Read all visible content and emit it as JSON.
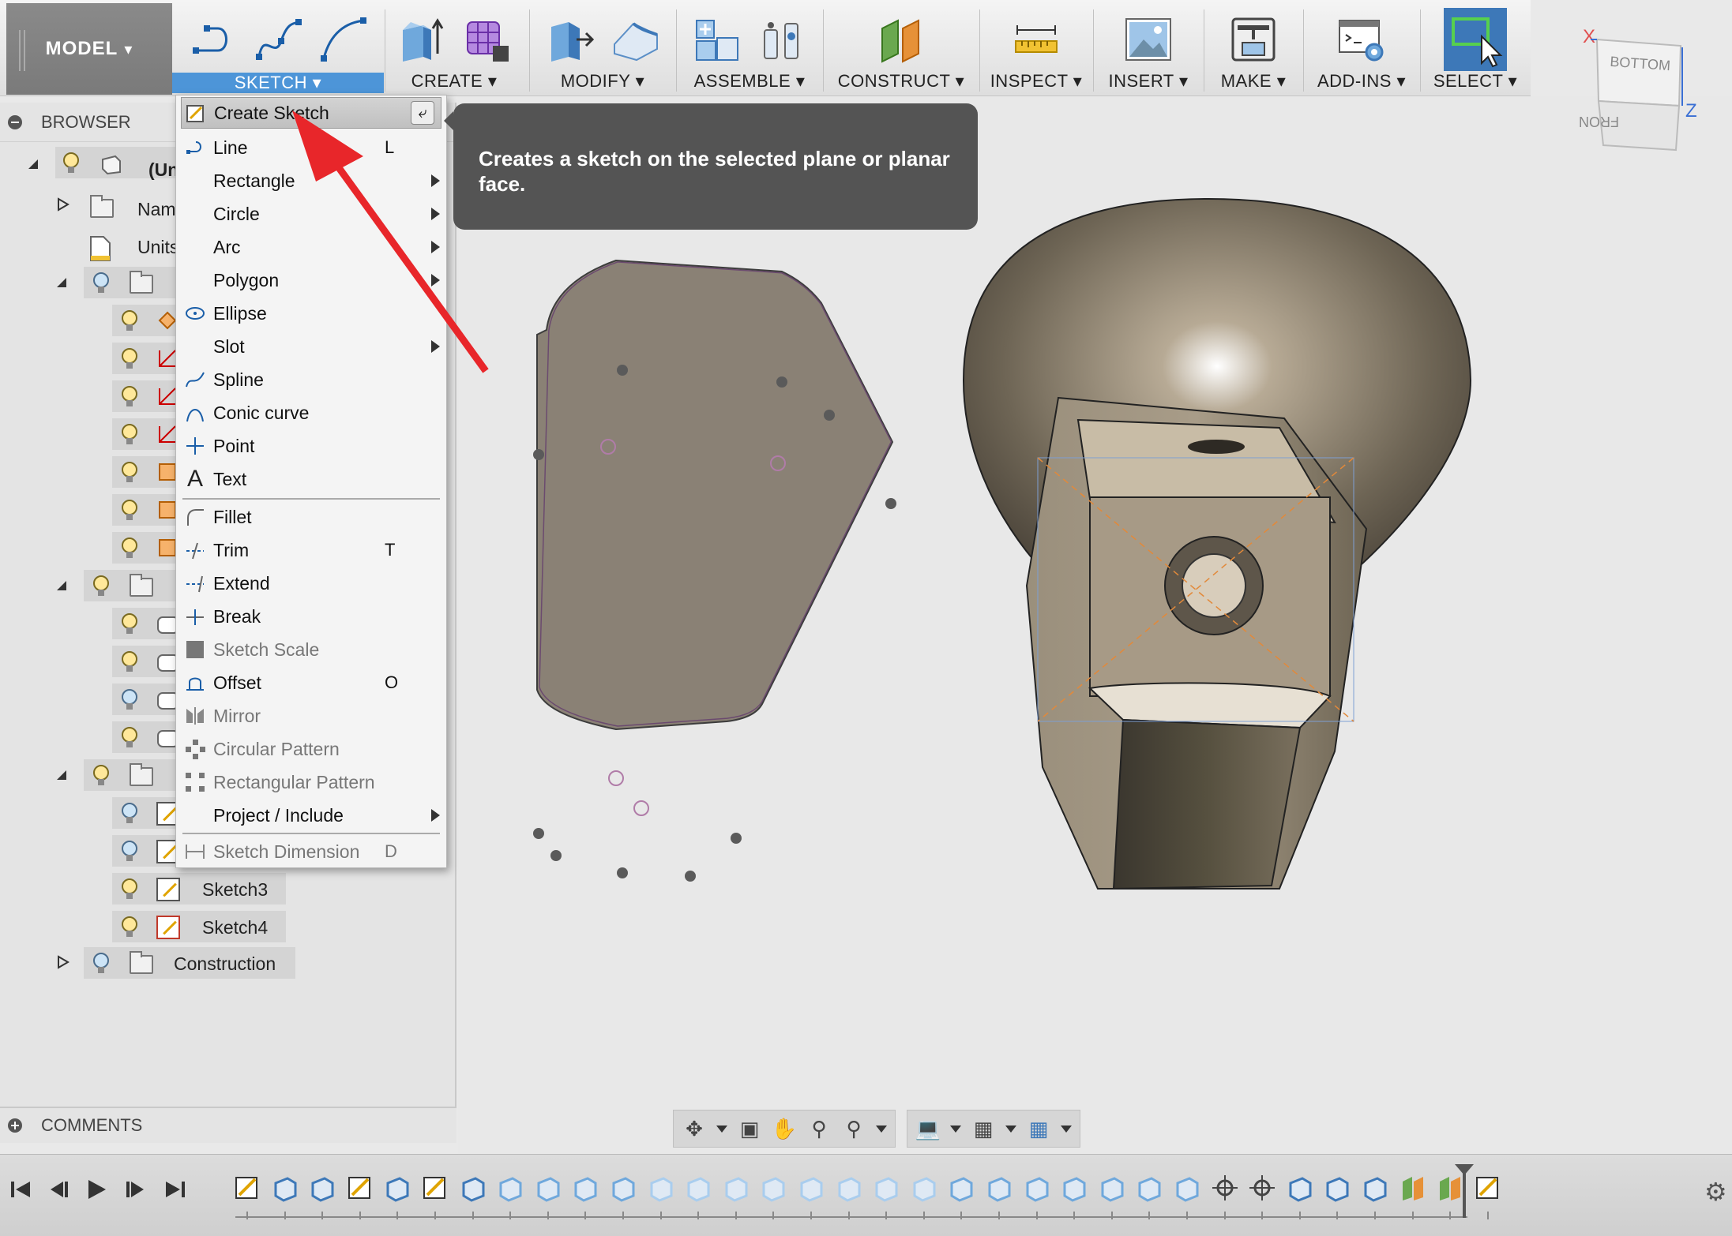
{
  "toolbar": {
    "model_label": "MODEL",
    "groups": [
      {
        "id": "sketch",
        "label": "SKETCH"
      },
      {
        "id": "create",
        "label": "CREATE"
      },
      {
        "id": "modify",
        "label": "MODIFY"
      },
      {
        "id": "assemble",
        "label": "ASSEMBLE"
      },
      {
        "id": "construct",
        "label": "CONSTRUCT"
      },
      {
        "id": "inspect",
        "label": "INSPECT"
      },
      {
        "id": "insert",
        "label": "INSERT"
      },
      {
        "id": "make",
        "label": "MAKE"
      },
      {
        "id": "addins",
        "label": "ADD-INS"
      },
      {
        "id": "select",
        "label": "SELECT"
      }
    ],
    "caret": "▾"
  },
  "browser": {
    "title": "BROWSER",
    "rows": [
      {
        "label": "(Un"
      },
      {
        "label": "Nam"
      },
      {
        "label": "Units"
      },
      {
        "label": "Sketch3"
      },
      {
        "label": "Sketch4"
      },
      {
        "label": "Construction"
      }
    ]
  },
  "comments": {
    "title": "COMMENTS"
  },
  "sketch_menu": {
    "items": [
      {
        "label": "Create Sketch",
        "shortcut": "",
        "enter_key": "⤶"
      },
      {
        "label": "Line",
        "shortcut": "L"
      },
      {
        "label": "Rectangle",
        "shortcut": ""
      },
      {
        "label": "Circle",
        "shortcut": ""
      },
      {
        "label": "Arc",
        "shortcut": ""
      },
      {
        "label": "Polygon",
        "shortcut": ""
      },
      {
        "label": "Ellipse",
        "shortcut": ""
      },
      {
        "label": "Slot",
        "shortcut": ""
      },
      {
        "label": "Spline",
        "shortcut": ""
      },
      {
        "label": "Conic curve",
        "shortcut": ""
      },
      {
        "label": "Point",
        "shortcut": ""
      },
      {
        "label": "Text",
        "shortcut": ""
      },
      {
        "label": "Fillet",
        "shortcut": ""
      },
      {
        "label": "Trim",
        "shortcut": "T"
      },
      {
        "label": "Extend",
        "shortcut": ""
      },
      {
        "label": "Break",
        "shortcut": ""
      },
      {
        "label": "Sketch Scale",
        "shortcut": ""
      },
      {
        "label": "Offset",
        "shortcut": "O"
      },
      {
        "label": "Mirror",
        "shortcut": ""
      },
      {
        "label": "Circular Pattern",
        "shortcut": ""
      },
      {
        "label": "Rectangular Pattern",
        "shortcut": ""
      },
      {
        "label": "Project / Include",
        "shortcut": ""
      },
      {
        "label": "Sketch Dimension",
        "shortcut": "D"
      }
    ]
  },
  "tooltip": {
    "text": "Creates a sketch on the selected plane or planar face."
  },
  "viewcube": {
    "top_label": "BOTTOM",
    "front_label": "FRONT",
    "axis_x": "X",
    "axis_z": "Z"
  },
  "colors": {
    "accent": "#4d95d8",
    "tooltip_bg": "#545454",
    "annotation_arrow": "#e8262a",
    "model_btn": "#808080"
  }
}
